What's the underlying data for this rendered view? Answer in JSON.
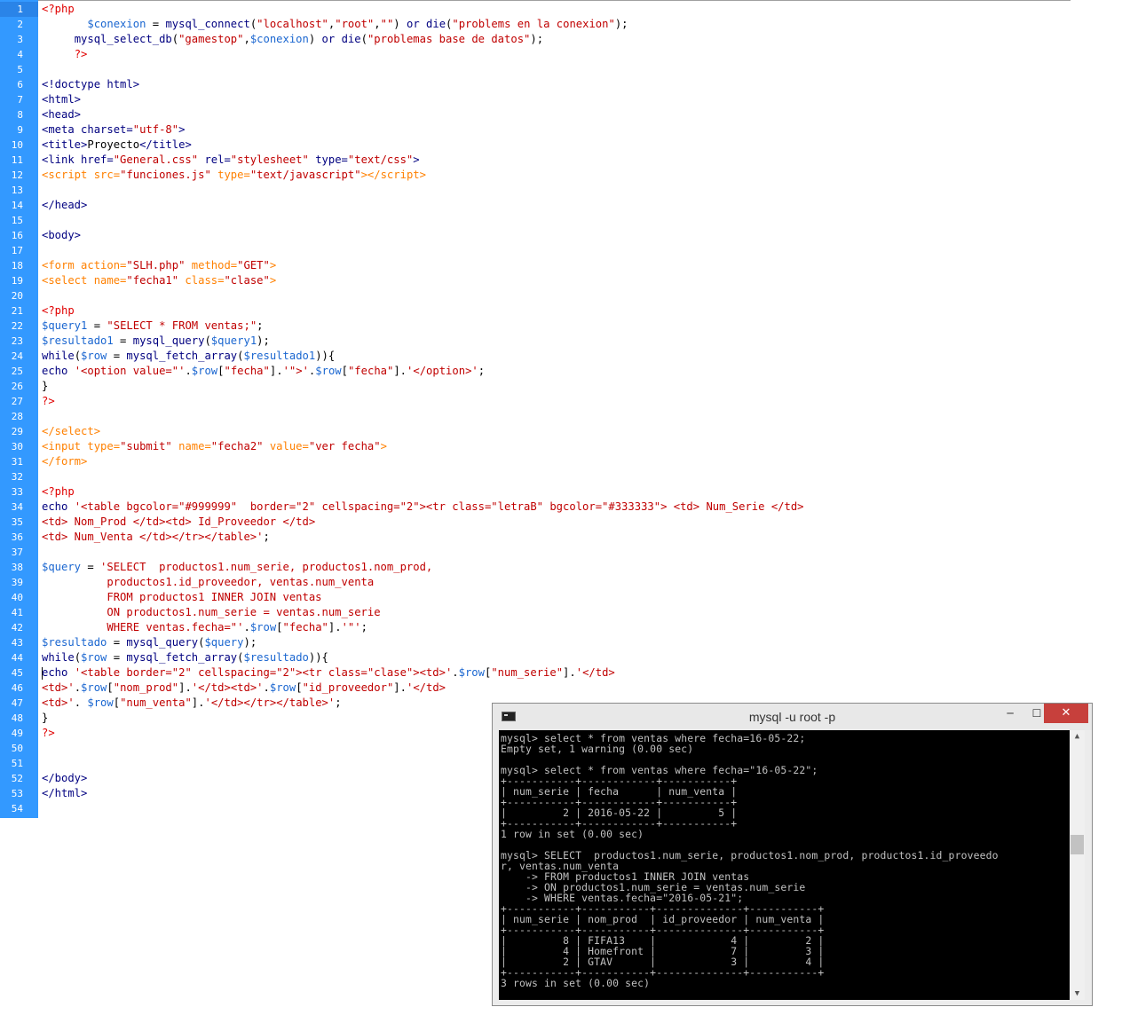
{
  "editor": {
    "line_numbers": [
      "1",
      "2",
      "3",
      "4",
      "5",
      "6",
      "7",
      "8",
      "9",
      "10",
      "11",
      "12",
      "13",
      "14",
      "15",
      "16",
      "17",
      "18",
      "19",
      "20",
      "21",
      "22",
      "23",
      "24",
      "25",
      "26",
      "27",
      "28",
      "29",
      "30",
      "31",
      "32",
      "33",
      "34",
      "35",
      "36",
      "37",
      "38",
      "39",
      "40",
      "41",
      "42",
      "43",
      "44",
      "45",
      "46",
      "47",
      "48",
      "49",
      "50",
      "51",
      "52",
      "53",
      "54"
    ],
    "lines": [
      [
        [
          "php",
          "<?php"
        ]
      ],
      [
        [
          "",
          "       "
        ],
        [
          "var",
          "$conexion"
        ],
        [
          "",
          " = "
        ],
        [
          "fn",
          "mysql_connect"
        ],
        [
          "",
          "("
        ],
        [
          "str",
          "\"localhost\""
        ],
        [
          "",
          ","
        ],
        [
          "str",
          "\"root\""
        ],
        [
          "",
          ","
        ],
        [
          "str",
          "\"\""
        ],
        [
          "",
          ") "
        ],
        [
          "kw",
          "or"
        ],
        [
          "",
          " "
        ],
        [
          "fn",
          "die"
        ],
        [
          "",
          "("
        ],
        [
          "str",
          "\"problems en la conexion\""
        ],
        [
          "",
          ");"
        ]
      ],
      [
        [
          "",
          "     "
        ],
        [
          "fn",
          "mysql_select_db"
        ],
        [
          "",
          "("
        ],
        [
          "str",
          "\"gamestop\""
        ],
        [
          "",
          ","
        ],
        [
          "var",
          "$conexion"
        ],
        [
          "",
          ") "
        ],
        [
          "kw",
          "or"
        ],
        [
          "",
          " "
        ],
        [
          "fn",
          "die"
        ],
        [
          "",
          "("
        ],
        [
          "str",
          "\"problemas base de datos\""
        ],
        [
          "",
          ");"
        ]
      ],
      [
        [
          "",
          "     "
        ],
        [
          "php",
          "?>"
        ]
      ],
      [],
      [
        [
          "html",
          "<!doctype html>"
        ]
      ],
      [
        [
          "html",
          "<html>"
        ]
      ],
      [
        [
          "html",
          "<head>"
        ]
      ],
      [
        [
          "html",
          "<meta charset="
        ],
        [
          "str",
          "\"utf-8\""
        ],
        [
          "html",
          ">"
        ]
      ],
      [
        [
          "html",
          "<title>"
        ],
        [
          "",
          "Proyecto"
        ],
        [
          "html",
          "</title>"
        ]
      ],
      [
        [
          "html",
          "<link href="
        ],
        [
          "str",
          "\"General.css\""
        ],
        [
          "html",
          " rel="
        ],
        [
          "str",
          "\"stylesheet\""
        ],
        [
          "html",
          " type="
        ],
        [
          "str",
          "\"text/css\""
        ],
        [
          "html",
          ">"
        ]
      ],
      [
        [
          "tag",
          "<script src="
        ],
        [
          "str",
          "\"funciones.js\""
        ],
        [
          "tag",
          " type="
        ],
        [
          "str",
          "\"text/javascript\""
        ],
        [
          "tag",
          "></"
        ],
        [
          "tag",
          "script>"
        ]
      ],
      [],
      [
        [
          "html",
          "</head>"
        ]
      ],
      [],
      [
        [
          "html",
          "<body>"
        ]
      ],
      [],
      [
        [
          "tag",
          "<form action="
        ],
        [
          "str",
          "\"SLH.php\""
        ],
        [
          "tag",
          " method="
        ],
        [
          "str",
          "\"GET\""
        ],
        [
          "tag",
          ">"
        ]
      ],
      [
        [
          "tag",
          "<select name="
        ],
        [
          "str",
          "\"fecha1\""
        ],
        [
          "tag",
          " class="
        ],
        [
          "str",
          "\"clase\""
        ],
        [
          "tag",
          ">"
        ]
      ],
      [],
      [
        [
          "php",
          "<?php"
        ]
      ],
      [
        [
          "var",
          "$query1"
        ],
        [
          "",
          " = "
        ],
        [
          "str",
          "\"SELECT * FROM ventas;\""
        ],
        [
          "",
          ";"
        ]
      ],
      [
        [
          "var",
          "$resultado1"
        ],
        [
          "",
          " = "
        ],
        [
          "fn",
          "mysql_query"
        ],
        [
          "",
          "("
        ],
        [
          "var",
          "$query1"
        ],
        [
          "",
          ");"
        ]
      ],
      [
        [
          "kw",
          "while"
        ],
        [
          "",
          "("
        ],
        [
          "var",
          "$row"
        ],
        [
          "",
          " = "
        ],
        [
          "fn",
          "mysql_fetch_array"
        ],
        [
          "",
          "("
        ],
        [
          "var",
          "$resultado1"
        ],
        [
          "",
          ")){"
        ]
      ],
      [
        [
          "kw",
          "echo"
        ],
        [
          "",
          " "
        ],
        [
          "str",
          "'<option value=\"'"
        ],
        [
          "",
          "."
        ],
        [
          "var",
          "$row"
        ],
        [
          "",
          "["
        ],
        [
          "str",
          "\"fecha\""
        ],
        [
          "",
          "]."
        ],
        [
          "str",
          "'\">'"
        ],
        [
          "",
          "."
        ],
        [
          "var",
          "$row"
        ],
        [
          "",
          "["
        ],
        [
          "str",
          "\"fecha\""
        ],
        [
          "",
          "]."
        ],
        [
          "str",
          "'</option>'"
        ],
        [
          "",
          ";"
        ]
      ],
      [
        [
          "",
          "}"
        ]
      ],
      [
        [
          "php",
          "?>"
        ]
      ],
      [],
      [
        [
          "tag",
          "</select>"
        ]
      ],
      [
        [
          "tag",
          "<input type="
        ],
        [
          "str",
          "\"submit\""
        ],
        [
          "tag",
          " name="
        ],
        [
          "str",
          "\"fecha2\""
        ],
        [
          "tag",
          " value="
        ],
        [
          "str",
          "\"ver fecha\""
        ],
        [
          "tag",
          ">"
        ]
      ],
      [
        [
          "tag",
          "</form>"
        ]
      ],
      [],
      [
        [
          "php",
          "<?php"
        ]
      ],
      [
        [
          "kw",
          "echo"
        ],
        [
          "",
          " "
        ],
        [
          "str",
          "'<table bgcolor=\"#999999\"  border=\"2\" cellspacing=\"2\"><tr class=\"letraB\" bgcolor=\"#333333\"> <td> Num_Serie </td>"
        ]
      ],
      [
        [
          "str",
          "<td> Nom_Prod </td><td> Id_Proveedor </td>"
        ]
      ],
      [
        [
          "str",
          "<td> Num_Venta </td></tr></table>'"
        ],
        [
          "",
          ";"
        ]
      ],
      [],
      [
        [
          "var",
          "$query"
        ],
        [
          "",
          " = "
        ],
        [
          "str",
          "'SELECT  productos1.num_serie, productos1.nom_prod,"
        ]
      ],
      [
        [
          "str",
          "          productos1.id_proveedor, ventas.num_venta"
        ]
      ],
      [
        [
          "str",
          "          FROM productos1 INNER JOIN ventas"
        ]
      ],
      [
        [
          "str",
          "          ON productos1.num_serie = ventas.num_serie"
        ]
      ],
      [
        [
          "str",
          "          WHERE ventas.fecha=\"'"
        ],
        [
          "",
          "."
        ],
        [
          "var",
          "$row"
        ],
        [
          "",
          "["
        ],
        [
          "str",
          "\"fecha\""
        ],
        [
          "",
          "]."
        ],
        [
          "str",
          "'\"'"
        ],
        [
          "",
          ";"
        ]
      ],
      [
        [
          "var",
          "$resultado"
        ],
        [
          "",
          " = "
        ],
        [
          "fn",
          "mysql_query"
        ],
        [
          "",
          "("
        ],
        [
          "var",
          "$query"
        ],
        [
          "",
          ");"
        ]
      ],
      [
        [
          "kw",
          "while"
        ],
        [
          "",
          "("
        ],
        [
          "var",
          "$row"
        ],
        [
          "",
          " = "
        ],
        [
          "fn",
          "mysql_fetch_array"
        ],
        [
          "",
          "("
        ],
        [
          "var",
          "$resultado"
        ],
        [
          "",
          ")){"
        ]
      ],
      [
        [
          "kw",
          "echo"
        ],
        [
          "",
          " "
        ],
        [
          "str",
          "'<table border=\"2\" cellspacing=\"2\"><tr class=\"clase\"><td>'"
        ],
        [
          "",
          "."
        ],
        [
          "var",
          "$row"
        ],
        [
          "",
          "["
        ],
        [
          "str",
          "\"num_serie\""
        ],
        [
          "",
          "]."
        ],
        [
          "str",
          "'</td>"
        ]
      ],
      [
        [
          "str",
          "<td>'"
        ],
        [
          "",
          "."
        ],
        [
          "var",
          "$row"
        ],
        [
          "",
          "["
        ],
        [
          "str",
          "\"nom_prod\""
        ],
        [
          "",
          "]."
        ],
        [
          "str",
          "'</td><td>'"
        ],
        [
          "",
          "."
        ],
        [
          "var",
          "$row"
        ],
        [
          "",
          "["
        ],
        [
          "str",
          "\"id_proveedor\""
        ],
        [
          "",
          "]."
        ],
        [
          "str",
          "'</td>"
        ]
      ],
      [
        [
          "str",
          "<td>'"
        ],
        [
          "",
          ". "
        ],
        [
          "var",
          "$row"
        ],
        [
          "",
          "["
        ],
        [
          "str",
          "\"num_venta\""
        ],
        [
          "",
          "]."
        ],
        [
          "str",
          "'</td></tr></table>'"
        ],
        [
          "",
          ";"
        ]
      ],
      [
        [
          "",
          "}"
        ]
      ],
      [
        [
          "php",
          "?>"
        ]
      ],
      [],
      [],
      [
        [
          "html",
          "</body>"
        ]
      ],
      [
        [
          "html",
          "</html>"
        ]
      ],
      []
    ]
  },
  "console": {
    "title": "mysql  -u root -p",
    "min_symbol": "─",
    "max_symbol": "☐",
    "close_symbol": "✕",
    "lines": [
      "mysql> select * from ventas where fecha=16-05-22;",
      "Empty set, 1 warning (0.00 sec)",
      "",
      "mysql> select * from ventas where fecha=\"16-05-22\";",
      "+-----------+------------+-----------+",
      "| num_serie | fecha      | num_venta |",
      "+-----------+------------+-----------+",
      "|         2 | 2016-05-22 |         5 |",
      "+-----------+------------+-----------+",
      "1 row in set (0.00 sec)",
      "",
      "mysql> SELECT  productos1.num_serie, productos1.nom_prod, productos1.id_proveedo",
      "r, ventas.num_venta",
      "    -> FROM productos1 INNER JOIN ventas",
      "    -> ON productos1.num_serie = ventas.num_serie",
      "    -> WHERE ventas.fecha=\"2016-05-21\";",
      "+-----------+-----------+--------------+-----------+",
      "| num_serie | nom_prod  | id_proveedor | num_venta |",
      "+-----------+-----------+--------------+-----------+",
      "|         8 | FIFA13    |            4 |         2 |",
      "|         4 | Homefront |            7 |         3 |",
      "|         2 | GTAV      |            3 |         4 |",
      "+-----------+-----------+--------------+-----------+",
      "3 rows in set (0.00 sec)"
    ]
  }
}
